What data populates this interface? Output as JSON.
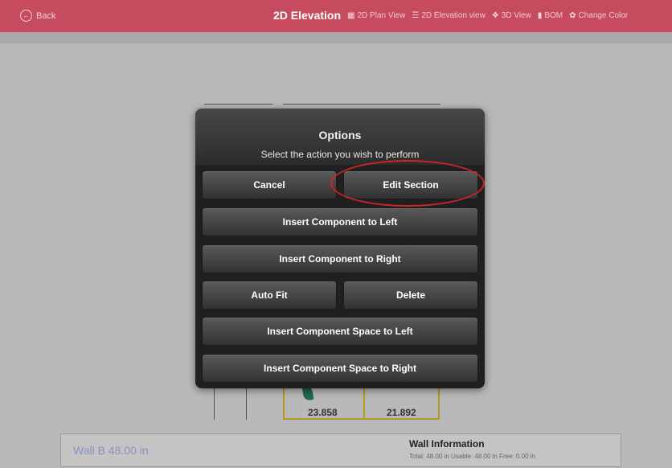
{
  "topbar": {
    "back_label": "Back",
    "title": "2D Elevation",
    "nav_items": [
      {
        "icon": "plan-view-icon",
        "glyph": "▦",
        "label": "2D Plan View"
      },
      {
        "icon": "elevation-view-icon",
        "glyph": "☰",
        "label": "2D Elevation view"
      },
      {
        "icon": "cube-3d-icon",
        "glyph": "❖",
        "label": "3D View"
      },
      {
        "icon": "document-icon",
        "glyph": "▮",
        "label": "BOM"
      },
      {
        "icon": "palette-icon",
        "glyph": "✿",
        "label": "Change Color"
      }
    ],
    "color": "#c74b5e"
  },
  "canvas": {
    "dimensions": [
      "23.858",
      "21.892"
    ]
  },
  "modal": {
    "title": "Options",
    "subtitle": "Select the action you wish to perform",
    "buttons": {
      "cancel": "Cancel",
      "edit_section": "Edit Section",
      "insert_left": "Insert Component to Left",
      "insert_right": "Insert Component to Right",
      "auto_fit": "Auto Fit",
      "delete": "Delete",
      "space_left": "Insert Component Space to Left",
      "space_right": "Insert Component Space to Right"
    },
    "highlight_color": "#d02424"
  },
  "wall_info": {
    "wall_label": "Wall B 48.00 in",
    "title": "Wall Information",
    "stats": "Total: 48.00 in   Usable: 48.00 in   Free: 0.00 in"
  }
}
